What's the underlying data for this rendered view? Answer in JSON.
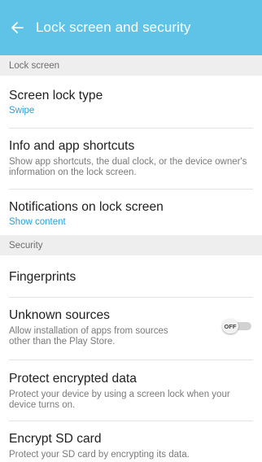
{
  "header": {
    "title": "Lock screen and security",
    "back_icon": "arrow-left-icon",
    "bg_color": "#5fc3e8"
  },
  "sections": {
    "lock_screen": "Lock screen",
    "security": "Security"
  },
  "items": {
    "screen_lock_type": {
      "title": "Screen lock type",
      "value": "Swipe"
    },
    "info_shortcuts": {
      "title": "Info and app shortcuts",
      "desc": "Show app shortcuts, the dual clock, or the device owner's information on the lock screen."
    },
    "notifications": {
      "title": "Notifications on lock screen",
      "value": "Show content"
    },
    "fingerprints": {
      "title": "Fingerprints"
    },
    "unknown_sources": {
      "title": "Unknown sources",
      "desc": "Allow installation of apps from sources other than the Play Store.",
      "toggle_label": "OFF"
    },
    "protect_encrypted": {
      "title": "Protect encrypted data",
      "desc": "Protect your device by using a screen lock when your device turns on."
    },
    "encrypt_sd": {
      "title": "Encrypt SD card",
      "desc": "Protect your SD card by encrypting its data."
    }
  },
  "accent_color": "#2b9fd4"
}
